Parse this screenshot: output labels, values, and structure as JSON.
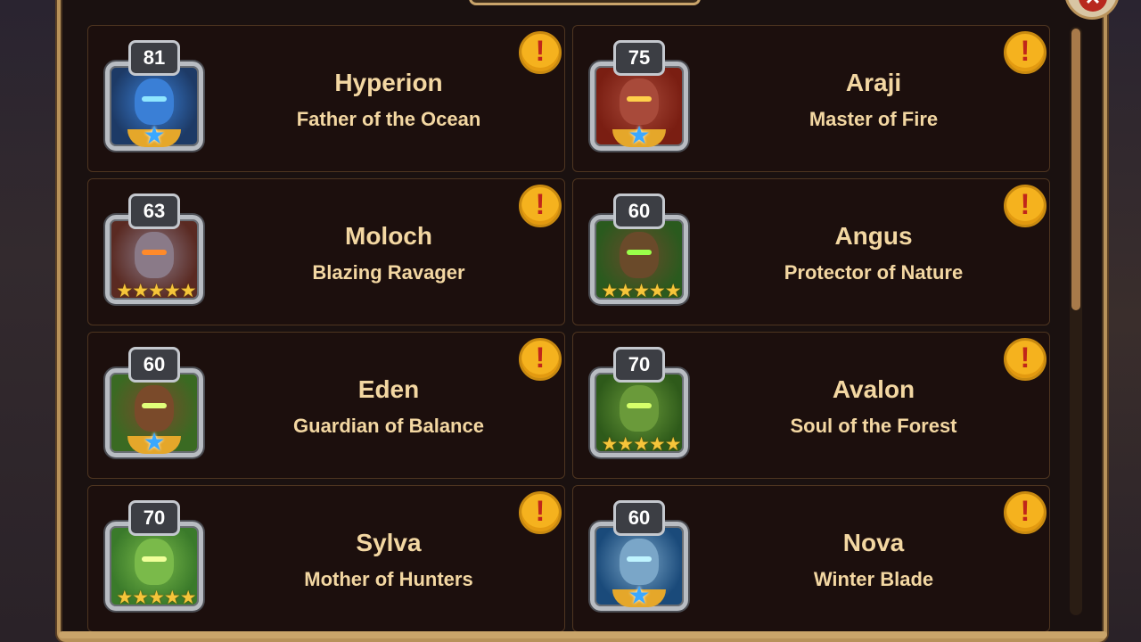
{
  "close_label": "✕",
  "heroes": [
    {
      "name": "Hyperion",
      "title": "Father of the Ocean",
      "level": "81",
      "stars": "",
      "blue_star": true,
      "icon": "hyperion-portrait-icon",
      "colors": {
        "bg": "#1d3a66",
        "face": "#3a7fd6",
        "eyes": "#8fe6ff"
      }
    },
    {
      "name": "Araji",
      "title": "Master of Fire",
      "level": "75",
      "stars": "",
      "blue_star": true,
      "icon": "araji-portrait-icon",
      "colors": {
        "bg": "#7a1e12",
        "face": "#a84a3a",
        "eyes": "#ffd04a"
      }
    },
    {
      "name": "Moloch",
      "title": "Blazing Ravager",
      "level": "63",
      "stars": "★★★★★",
      "blue_star": false,
      "icon": "moloch-portrait-icon",
      "colors": {
        "bg": "#5a2a22",
        "face": "#8a7a88",
        "eyes": "#ff8a2a"
      }
    },
    {
      "name": "Angus",
      "title": "Protector of Nature",
      "level": "60",
      "stars": "★★★★★",
      "blue_star": false,
      "icon": "angus-portrait-icon",
      "colors": {
        "bg": "#2a5a1e",
        "face": "#6a4a2a",
        "eyes": "#9aff4a"
      }
    },
    {
      "name": "Eden",
      "title": "Guardian of Balance",
      "level": "60",
      "stars": "",
      "blue_star": true,
      "icon": "eden-portrait-icon",
      "colors": {
        "bg": "#3a6a22",
        "face": "#7a4a2a",
        "eyes": "#e0ff7a"
      }
    },
    {
      "name": "Avalon",
      "title": "Soul of the Forest",
      "level": "70",
      "stars": "★★★★★",
      "blue_star": false,
      "icon": "avalon-portrait-icon",
      "colors": {
        "bg": "#2e5a1a",
        "face": "#6a9a3a",
        "eyes": "#d6ff6a"
      }
    },
    {
      "name": "Sylva",
      "title": "Mother of Hunters",
      "level": "70",
      "stars": "★★★★★",
      "blue_star": false,
      "icon": "sylva-portrait-icon",
      "colors": {
        "bg": "#3a7a2a",
        "face": "#7aba4a",
        "eyes": "#f0ff9a"
      }
    },
    {
      "name": "Nova",
      "title": "Winter Blade",
      "level": "60",
      "stars": "",
      "blue_star": true,
      "icon": "nova-portrait-icon",
      "colors": {
        "bg": "#1a4a7a",
        "face": "#7aa6c8",
        "eyes": "#bff4ff"
      }
    }
  ]
}
